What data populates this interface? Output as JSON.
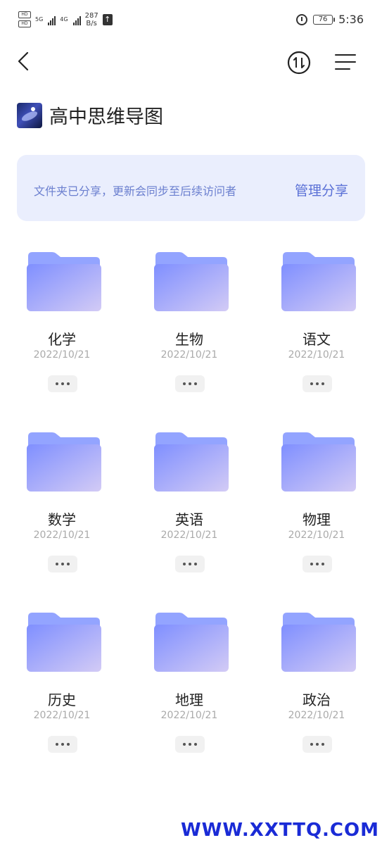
{
  "status_bar": {
    "sim1": "HD",
    "sim2": "HD",
    "network1": "5G",
    "network2": "4G",
    "speed_value": "287",
    "speed_unit": "B/s",
    "battery": "76",
    "time": "5:36",
    "icons": [
      "alarm-icon",
      "battery-icon",
      "upload-notification-icon"
    ]
  },
  "nav": {
    "icons": [
      "back-arrow-icon",
      "sort-icon",
      "menu-icon"
    ]
  },
  "folder_title": "高中思维导图",
  "banner": {
    "text": "文件夹已分享，更新会同步至后续访问者",
    "action": "管理分享"
  },
  "folders": [
    {
      "name": "化学",
      "date": "2022/10/21"
    },
    {
      "name": "生物",
      "date": "2022/10/21"
    },
    {
      "name": "语文",
      "date": "2022/10/21"
    },
    {
      "name": "数学",
      "date": "2022/10/21"
    },
    {
      "name": "英语",
      "date": "2022/10/21"
    },
    {
      "name": "物理",
      "date": "2022/10/21"
    },
    {
      "name": "历史",
      "date": "2022/10/21"
    },
    {
      "name": "地理",
      "date": "2022/10/21"
    },
    {
      "name": "政治",
      "date": "2022/10/21"
    }
  ],
  "colors": {
    "folder_top": "#8fa2ff",
    "folder_front_start": "#7f8fff",
    "folder_front_end": "#d3cbf5",
    "banner_bg": "#eaeefd",
    "banner_text": "#6b7fcf",
    "watermark": "#1a2bd6"
  },
  "watermark": "WWW.XXTTQ.COM"
}
